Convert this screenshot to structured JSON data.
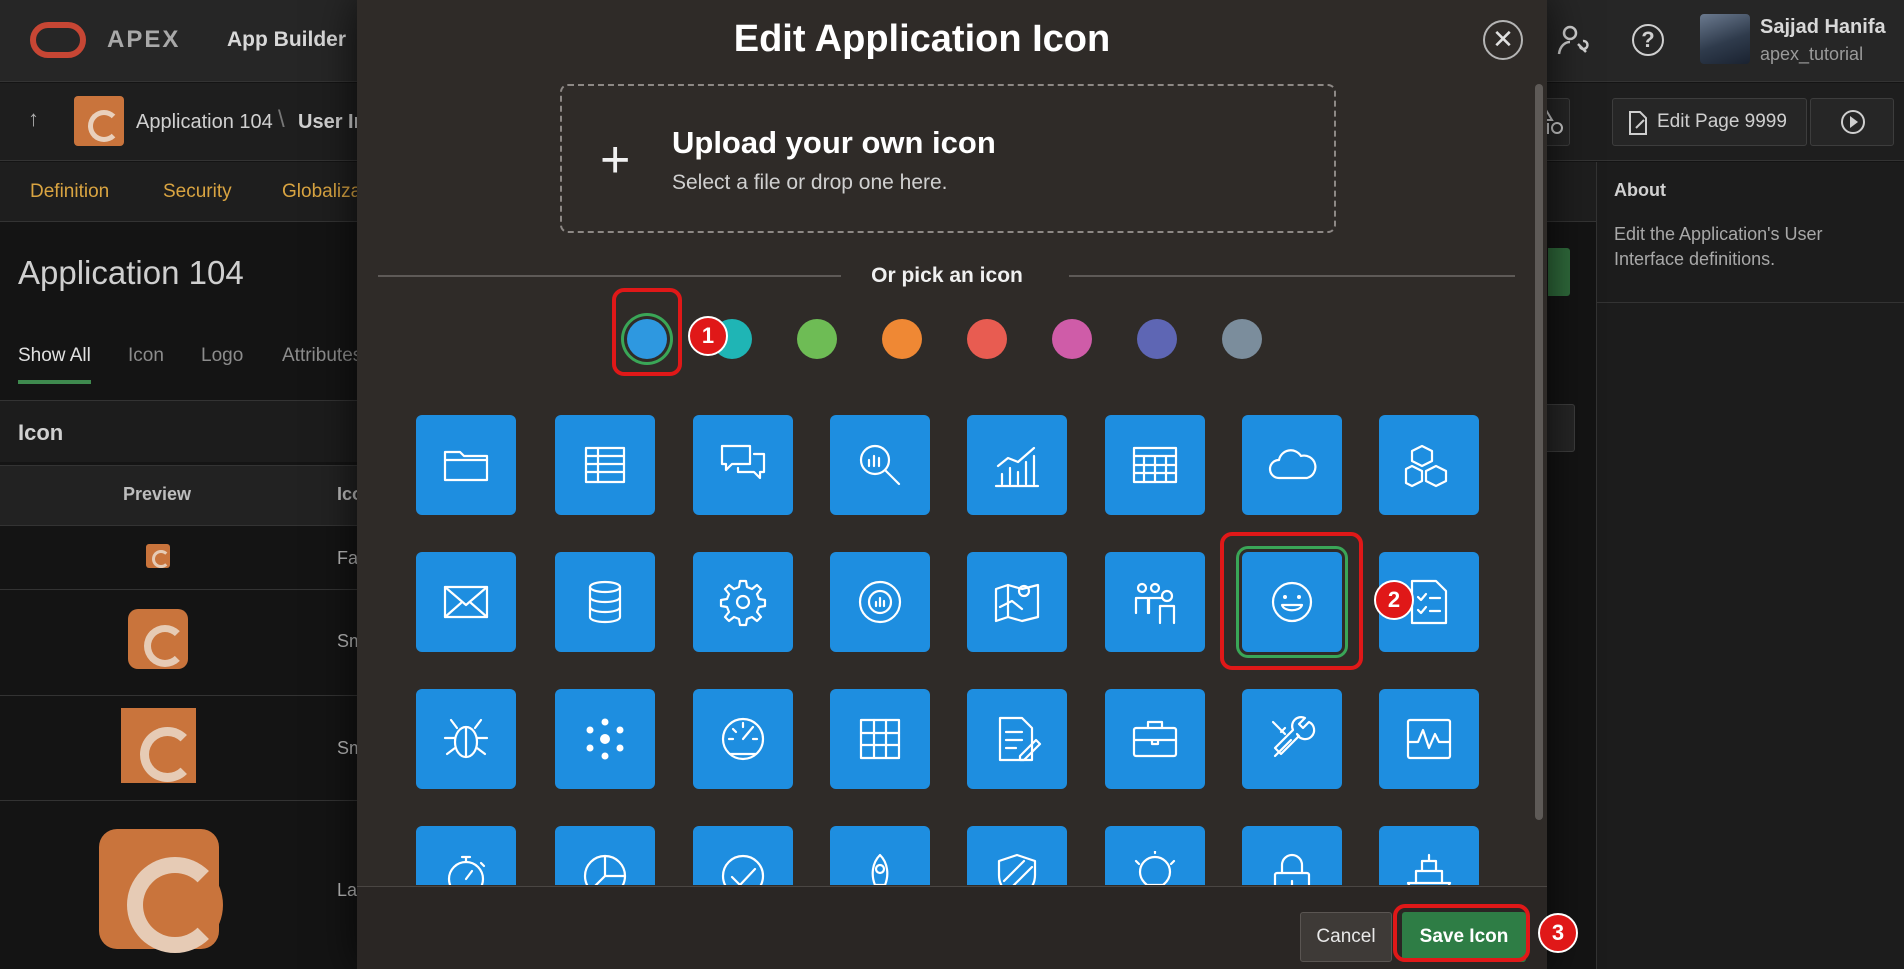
{
  "header": {
    "brand": "APEX",
    "app_builder": "App Builder",
    "user_name": "Sajjad Hanifa",
    "workspace": "apex_tutorial"
  },
  "breadcrumb": {
    "app_label": "Application 104",
    "separator": "\\",
    "current": "User In"
  },
  "nav_tabs": [
    "Definition",
    "Security",
    "Globaliza"
  ],
  "page": {
    "title": "Application 104",
    "subtabs": [
      "Show All",
      "Icon",
      "Logo",
      "Attributes"
    ],
    "region_title": "Icon",
    "columns": [
      "Preview",
      "Ico"
    ],
    "row_labels": [
      "Fa",
      "Sm",
      "Sm",
      "La"
    ]
  },
  "right_toolbar": {
    "edit_page": "Edit Page 9999"
  },
  "about": {
    "title": "About",
    "text": "Edit the Application's User Interface definitions."
  },
  "modal": {
    "title": "Edit Application Icon",
    "close_symbol": "✕",
    "upload_plus": "+",
    "upload_title": "Upload your own icon",
    "upload_subtitle": "Select a file or drop one here.",
    "pick_label": "Or pick an icon",
    "colors": [
      "#2e98e0",
      "#1fb5b5",
      "#6ebc55",
      "#ef8834",
      "#e85c51",
      "#cf5ca8",
      "#5e66b4",
      "#7b8d9c"
    ],
    "selected_color_index": 0,
    "icons": [
      "folder-icon",
      "table-icon",
      "chat-bubbles-icon",
      "search-chart-icon",
      "line-bar-chart-icon",
      "calendar-grid-icon",
      "cloud-icon",
      "cubes-icon",
      "envelope-icon",
      "database-icon",
      "gear-icon",
      "donut-chart-icon",
      "map-pin-icon",
      "people-icon",
      "smiley-icon",
      "checklist-icon",
      "bug-icon",
      "nodes-icon",
      "gauge-icon",
      "grid-icon",
      "document-edit-icon",
      "briefcase-icon",
      "wrench-screwdriver-icon",
      "pulse-icon",
      "stopwatch-icon",
      "pie-chart-icon",
      "checkmark-icon",
      "rocket-icon",
      "shield-icon",
      "lightbulb-icon",
      "lock-icon",
      "ship-icon"
    ],
    "selected_icon_index": 14,
    "cancel_label": "Cancel",
    "save_label": "Save Icon"
  },
  "annotations": [
    "1",
    "2",
    "3"
  ]
}
